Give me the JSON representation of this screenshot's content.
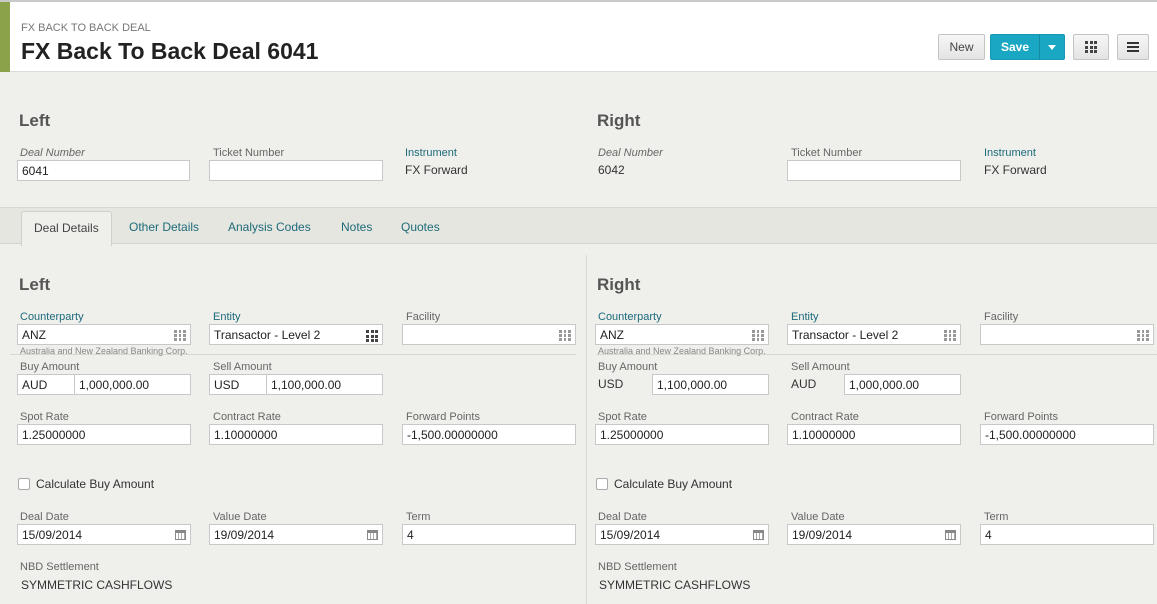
{
  "header": {
    "breadcrumb": "FX BACK TO BACK DEAL",
    "title": "FX Back To Back Deal 6041",
    "new_label": "New",
    "save_label": "Save"
  },
  "top": {
    "left": {
      "title": "Left",
      "deal_number_label": "Deal Number",
      "deal_number": "6041",
      "ticket_number_label": "Ticket Number",
      "ticket_number": "",
      "instrument_label": "Instrument",
      "instrument": "FX Forward"
    },
    "right": {
      "title": "Right",
      "deal_number_label": "Deal Number",
      "deal_number": "6042",
      "ticket_number_label": "Ticket Number",
      "ticket_number": "",
      "instrument_label": "Instrument",
      "instrument": "FX Forward"
    }
  },
  "tabs": [
    {
      "label": "Deal Details",
      "active": true
    },
    {
      "label": "Other Details"
    },
    {
      "label": "Analysis Codes"
    },
    {
      "label": "Notes"
    },
    {
      "label": "Quotes"
    }
  ],
  "details": {
    "left": {
      "title": "Left",
      "counterparty_label": "Counterparty",
      "counterparty": "ANZ",
      "counterparty_full": "Australia and New Zealand Banking Corp.",
      "entity_label": "Entity",
      "entity": "Transactor - Level 2",
      "facility_label": "Facility",
      "facility": "",
      "buy_amount_label": "Buy Amount",
      "buy_currency": "AUD",
      "buy_amount": "1,000,000.00",
      "sell_amount_label": "Sell Amount",
      "sell_currency": "USD",
      "sell_amount": "1,100,000.00",
      "spot_rate_label": "Spot Rate",
      "spot_rate": "1.25000000",
      "contract_rate_label": "Contract Rate",
      "contract_rate": "1.10000000",
      "forward_points_label": "Forward Points",
      "forward_points": "-1,500.00000000",
      "calc_label": "Calculate Buy Amount",
      "deal_date_label": "Deal Date",
      "deal_date": "15/09/2014",
      "value_date_label": "Value Date",
      "value_date": "19/09/2014",
      "term_label": "Term",
      "term": "4",
      "nbd_label": "NBD Settlement",
      "nbd": "SYMMETRIC CASHFLOWS"
    },
    "right": {
      "title": "Right",
      "counterparty_label": "Counterparty",
      "counterparty": "ANZ",
      "counterparty_full": "Australia and New Zealand Banking Corp.",
      "entity_label": "Entity",
      "entity": "Transactor - Level 2",
      "facility_label": "Facility",
      "facility": "",
      "buy_amount_label": "Buy Amount",
      "buy_currency": "USD",
      "buy_amount": "1,100,000.00",
      "sell_amount_label": "Sell Amount",
      "sell_currency": "AUD",
      "sell_amount": "1,000,000.00",
      "spot_rate_label": "Spot Rate",
      "spot_rate": "1.25000000",
      "contract_rate_label": "Contract Rate",
      "contract_rate": "1.10000000",
      "forward_points_label": "Forward Points",
      "forward_points": "-1,500.00000000",
      "calc_label": "Calculate Buy Amount",
      "deal_date_label": "Deal Date",
      "deal_date": "15/09/2014",
      "value_date_label": "Value Date",
      "value_date": "19/09/2014",
      "term_label": "Term",
      "term": "4",
      "nbd_label": "NBD Settlement",
      "nbd": "SYMMETRIC CASHFLOWS"
    }
  },
  "colors": {
    "accent": "#8ba24a",
    "primary_button": "#1aa7c4",
    "link": "#1c6a7a"
  }
}
